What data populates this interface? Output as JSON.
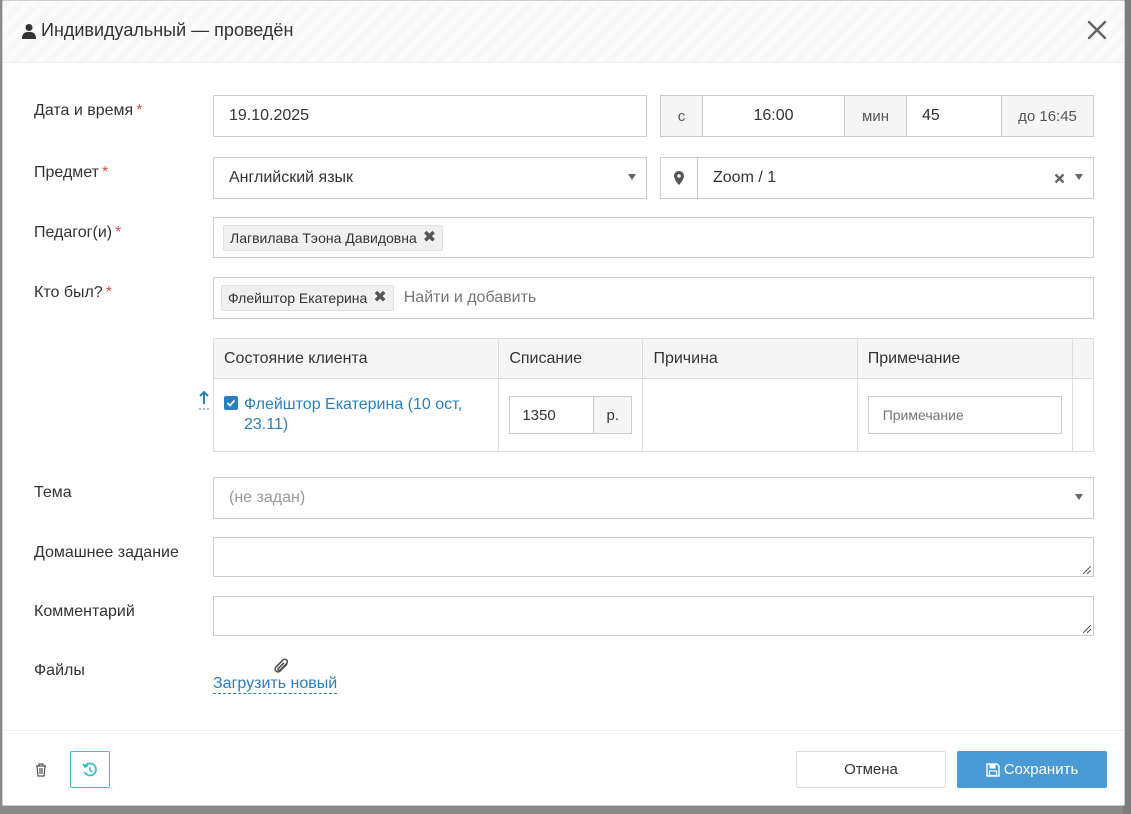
{
  "modal": {
    "title": "Индивидуальный — проведён",
    "icons": {
      "title": "user-icon",
      "close": "close-icon"
    }
  },
  "form": {
    "datetime": {
      "label": "Дата и время",
      "required_mark": "*",
      "date_value": "19.10.2025",
      "from_label": "с",
      "time_value": "16:00",
      "min_label": "мин",
      "duration_value": "45",
      "end_label": "до 16:45"
    },
    "subject": {
      "label": "Предмет",
      "required_mark": "*",
      "value": "Английский язык",
      "location_value": "Zoom / 1",
      "location_icon": "map-marker-icon"
    },
    "teachers": {
      "label": "Педагог(и)",
      "required_mark": "*",
      "tags": [
        "Лагвилава Тэона Давидовна"
      ]
    },
    "attendees": {
      "label": "Кто был?",
      "required_mark": "*",
      "tags": [
        "Флейштор Екатерина"
      ],
      "search_placeholder": "Найти и добавить"
    },
    "clients_table": {
      "headers": [
        "Состояние клиента",
        "Списание",
        "Причина",
        "Примечание"
      ],
      "rows": [
        {
          "checked": true,
          "client": "Флейштор Екатерина (10 ост, 23.11)",
          "charge": "1350",
          "currency": "р.",
          "reason": "",
          "note_placeholder": "Примечание"
        }
      ]
    },
    "topic": {
      "label": "Тема",
      "placeholder": "(не задан)"
    },
    "homework": {
      "label": "Домашнее задание",
      "value": ""
    },
    "comment": {
      "label": "Комментарий",
      "value": ""
    },
    "files": {
      "label": "Файлы",
      "upload_label": "Загрузить новый",
      "icon": "paperclip-icon"
    }
  },
  "footer": {
    "delete_icon": "trash-icon",
    "history_icon": "history-icon",
    "cancel_label": "Отмена",
    "save_label": "Сохранить",
    "save_icon": "floppy-disk-icon"
  },
  "colors": {
    "accent": "#2a7fc0",
    "save_button": "#4a9ad6",
    "required": "#d9534f",
    "history_border": "#3fc0c0"
  }
}
